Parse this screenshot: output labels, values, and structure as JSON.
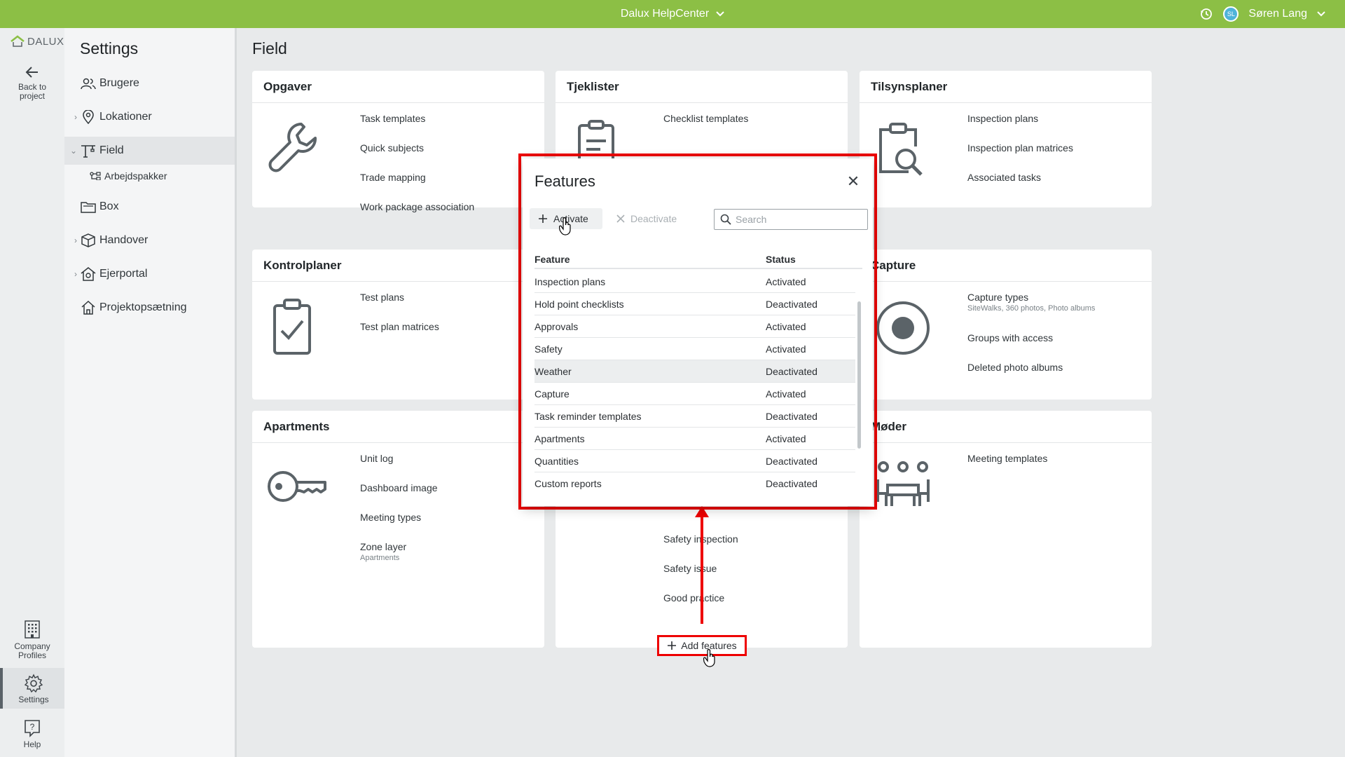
{
  "topbar": {
    "center_title": "Dalux HelpCenter",
    "user_initials": "SL",
    "user_name": "Søren Lang"
  },
  "rail": {
    "logo_text": "DALUX",
    "back_label_1": "Back to",
    "back_label_2": "project",
    "company_label_1": "Company",
    "company_label_2": "Profiles",
    "settings_label": "Settings",
    "help_label": "Help"
  },
  "nav": {
    "title": "Settings",
    "items": [
      {
        "label": "Brugere"
      },
      {
        "label": "Lokationer"
      },
      {
        "label": "Field"
      },
      {
        "label": "Arbejdspakker"
      },
      {
        "label": "Box"
      },
      {
        "label": "Handover"
      },
      {
        "label": "Ejerportal"
      },
      {
        "label": "Projektopsætning"
      }
    ]
  },
  "main": {
    "title": "Field",
    "cards": {
      "opgaver": {
        "title": "Opgaver",
        "links": [
          "Task templates",
          "Quick subjects",
          "Trade mapping",
          "Work package association"
        ]
      },
      "tjeklister": {
        "title": "Tjeklister",
        "links": [
          "Checklist templates",
          "Safety inspection",
          "Safety issue",
          "Good practice"
        ]
      },
      "tilsynsplaner": {
        "title": "Tilsynsplaner",
        "links": [
          "Inspection plans",
          "Inspection plan matrices",
          "Associated tasks"
        ]
      },
      "kontrolplaner": {
        "title": "Kontrolplaner",
        "links": [
          "Test plans",
          "Test plan matrices"
        ]
      },
      "capture": {
        "title": "Capture",
        "links": [
          "Capture types",
          "Groups with access",
          "Deleted photo albums"
        ],
        "capture_sub": "SiteWalks, 360 photos, Photo albums"
      },
      "apartments": {
        "title": "Apartments",
        "links": [
          "Unit log",
          "Dashboard image",
          "Meeting types",
          "Zone layer"
        ],
        "zone_sub": "Apartments"
      },
      "moder": {
        "title": "Møder",
        "links": [
          "Meeting templates"
        ]
      }
    },
    "add_features_label": "Add features"
  },
  "dialog": {
    "title": "Features",
    "activate_label": "Activate",
    "deactivate_label": "Deactivate",
    "search_placeholder": "Search",
    "col_feature": "Feature",
    "col_status": "Status",
    "rows": [
      {
        "feature": "Inspection plans",
        "status": "Activated"
      },
      {
        "feature": "Hold point checklists",
        "status": "Deactivated"
      },
      {
        "feature": "Approvals",
        "status": "Activated"
      },
      {
        "feature": "Safety",
        "status": "Activated"
      },
      {
        "feature": "Weather",
        "status": "Deactivated"
      },
      {
        "feature": "Capture",
        "status": "Activated"
      },
      {
        "feature": "Task reminder templates",
        "status": "Deactivated"
      },
      {
        "feature": "Apartments",
        "status": "Activated"
      },
      {
        "feature": "Quantities",
        "status": "Deactivated"
      },
      {
        "feature": "Custom reports",
        "status": "Deactivated"
      }
    ]
  },
  "colors": {
    "topbar": "#8cbf45",
    "highlight_frame": "#ee0000",
    "avatar": "#4fb3d9"
  },
  "icons": [
    "chevron-down-icon",
    "history-icon",
    "home-logo-icon",
    "arrow-left-icon",
    "users-icon",
    "location-pin-icon",
    "crane-icon",
    "packages-icon",
    "folder-icon",
    "cube-icon",
    "house-gear-icon",
    "house-icon",
    "building-icon",
    "gear-icon",
    "help-icon",
    "wrench-icon",
    "clipboard-icon",
    "clipboard-search-icon",
    "clipboard-check-icon",
    "record-icon",
    "key-icon",
    "people-table-icon",
    "plus-icon",
    "close-icon",
    "search-icon",
    "cursor-hand-icon"
  ]
}
